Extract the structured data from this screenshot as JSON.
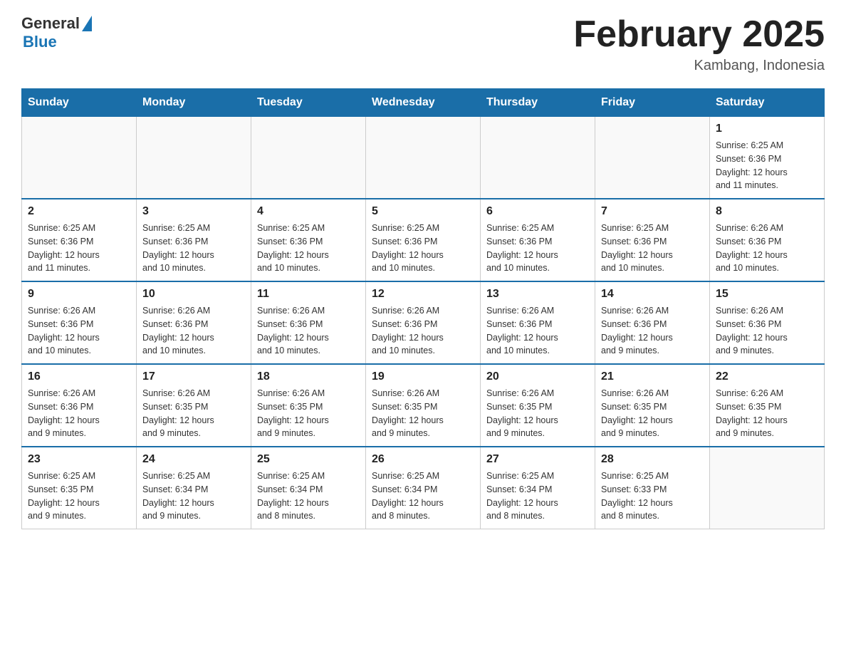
{
  "header": {
    "logo_general": "General",
    "logo_blue": "Blue",
    "month_title": "February 2025",
    "location": "Kambang, Indonesia"
  },
  "days_of_week": [
    "Sunday",
    "Monday",
    "Tuesday",
    "Wednesday",
    "Thursday",
    "Friday",
    "Saturday"
  ],
  "weeks": [
    [
      {
        "day": "",
        "info": ""
      },
      {
        "day": "",
        "info": ""
      },
      {
        "day": "",
        "info": ""
      },
      {
        "day": "",
        "info": ""
      },
      {
        "day": "",
        "info": ""
      },
      {
        "day": "",
        "info": ""
      },
      {
        "day": "1",
        "info": "Sunrise: 6:25 AM\nSunset: 6:36 PM\nDaylight: 12 hours\nand 11 minutes."
      }
    ],
    [
      {
        "day": "2",
        "info": "Sunrise: 6:25 AM\nSunset: 6:36 PM\nDaylight: 12 hours\nand 11 minutes."
      },
      {
        "day": "3",
        "info": "Sunrise: 6:25 AM\nSunset: 6:36 PM\nDaylight: 12 hours\nand 10 minutes."
      },
      {
        "day": "4",
        "info": "Sunrise: 6:25 AM\nSunset: 6:36 PM\nDaylight: 12 hours\nand 10 minutes."
      },
      {
        "day": "5",
        "info": "Sunrise: 6:25 AM\nSunset: 6:36 PM\nDaylight: 12 hours\nand 10 minutes."
      },
      {
        "day": "6",
        "info": "Sunrise: 6:25 AM\nSunset: 6:36 PM\nDaylight: 12 hours\nand 10 minutes."
      },
      {
        "day": "7",
        "info": "Sunrise: 6:25 AM\nSunset: 6:36 PM\nDaylight: 12 hours\nand 10 minutes."
      },
      {
        "day": "8",
        "info": "Sunrise: 6:26 AM\nSunset: 6:36 PM\nDaylight: 12 hours\nand 10 minutes."
      }
    ],
    [
      {
        "day": "9",
        "info": "Sunrise: 6:26 AM\nSunset: 6:36 PM\nDaylight: 12 hours\nand 10 minutes."
      },
      {
        "day": "10",
        "info": "Sunrise: 6:26 AM\nSunset: 6:36 PM\nDaylight: 12 hours\nand 10 minutes."
      },
      {
        "day": "11",
        "info": "Sunrise: 6:26 AM\nSunset: 6:36 PM\nDaylight: 12 hours\nand 10 minutes."
      },
      {
        "day": "12",
        "info": "Sunrise: 6:26 AM\nSunset: 6:36 PM\nDaylight: 12 hours\nand 10 minutes."
      },
      {
        "day": "13",
        "info": "Sunrise: 6:26 AM\nSunset: 6:36 PM\nDaylight: 12 hours\nand 10 minutes."
      },
      {
        "day": "14",
        "info": "Sunrise: 6:26 AM\nSunset: 6:36 PM\nDaylight: 12 hours\nand 9 minutes."
      },
      {
        "day": "15",
        "info": "Sunrise: 6:26 AM\nSunset: 6:36 PM\nDaylight: 12 hours\nand 9 minutes."
      }
    ],
    [
      {
        "day": "16",
        "info": "Sunrise: 6:26 AM\nSunset: 6:36 PM\nDaylight: 12 hours\nand 9 minutes."
      },
      {
        "day": "17",
        "info": "Sunrise: 6:26 AM\nSunset: 6:35 PM\nDaylight: 12 hours\nand 9 minutes."
      },
      {
        "day": "18",
        "info": "Sunrise: 6:26 AM\nSunset: 6:35 PM\nDaylight: 12 hours\nand 9 minutes."
      },
      {
        "day": "19",
        "info": "Sunrise: 6:26 AM\nSunset: 6:35 PM\nDaylight: 12 hours\nand 9 minutes."
      },
      {
        "day": "20",
        "info": "Sunrise: 6:26 AM\nSunset: 6:35 PM\nDaylight: 12 hours\nand 9 minutes."
      },
      {
        "day": "21",
        "info": "Sunrise: 6:26 AM\nSunset: 6:35 PM\nDaylight: 12 hours\nand 9 minutes."
      },
      {
        "day": "22",
        "info": "Sunrise: 6:26 AM\nSunset: 6:35 PM\nDaylight: 12 hours\nand 9 minutes."
      }
    ],
    [
      {
        "day": "23",
        "info": "Sunrise: 6:25 AM\nSunset: 6:35 PM\nDaylight: 12 hours\nand 9 minutes."
      },
      {
        "day": "24",
        "info": "Sunrise: 6:25 AM\nSunset: 6:34 PM\nDaylight: 12 hours\nand 9 minutes."
      },
      {
        "day": "25",
        "info": "Sunrise: 6:25 AM\nSunset: 6:34 PM\nDaylight: 12 hours\nand 8 minutes."
      },
      {
        "day": "26",
        "info": "Sunrise: 6:25 AM\nSunset: 6:34 PM\nDaylight: 12 hours\nand 8 minutes."
      },
      {
        "day": "27",
        "info": "Sunrise: 6:25 AM\nSunset: 6:34 PM\nDaylight: 12 hours\nand 8 minutes."
      },
      {
        "day": "28",
        "info": "Sunrise: 6:25 AM\nSunset: 6:33 PM\nDaylight: 12 hours\nand 8 minutes."
      },
      {
        "day": "",
        "info": ""
      }
    ]
  ]
}
